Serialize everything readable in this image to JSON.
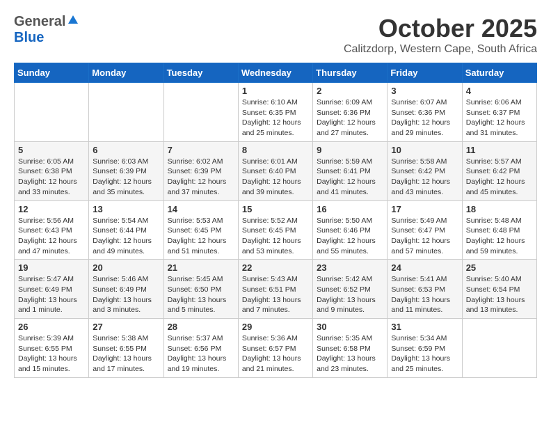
{
  "logo": {
    "general": "General",
    "blue": "Blue"
  },
  "title": "October 2025",
  "subtitle": "Calitzdorp, Western Cape, South Africa",
  "headers": [
    "Sunday",
    "Monday",
    "Tuesday",
    "Wednesday",
    "Thursday",
    "Friday",
    "Saturday"
  ],
  "weeks": [
    [
      {
        "day": "",
        "info": ""
      },
      {
        "day": "",
        "info": ""
      },
      {
        "day": "",
        "info": ""
      },
      {
        "day": "1",
        "info": "Sunrise: 6:10 AM\nSunset: 6:35 PM\nDaylight: 12 hours\nand 25 minutes."
      },
      {
        "day": "2",
        "info": "Sunrise: 6:09 AM\nSunset: 6:36 PM\nDaylight: 12 hours\nand 27 minutes."
      },
      {
        "day": "3",
        "info": "Sunrise: 6:07 AM\nSunset: 6:36 PM\nDaylight: 12 hours\nand 29 minutes."
      },
      {
        "day": "4",
        "info": "Sunrise: 6:06 AM\nSunset: 6:37 PM\nDaylight: 12 hours\nand 31 minutes."
      }
    ],
    [
      {
        "day": "5",
        "info": "Sunrise: 6:05 AM\nSunset: 6:38 PM\nDaylight: 12 hours\nand 33 minutes."
      },
      {
        "day": "6",
        "info": "Sunrise: 6:03 AM\nSunset: 6:39 PM\nDaylight: 12 hours\nand 35 minutes."
      },
      {
        "day": "7",
        "info": "Sunrise: 6:02 AM\nSunset: 6:39 PM\nDaylight: 12 hours\nand 37 minutes."
      },
      {
        "day": "8",
        "info": "Sunrise: 6:01 AM\nSunset: 6:40 PM\nDaylight: 12 hours\nand 39 minutes."
      },
      {
        "day": "9",
        "info": "Sunrise: 5:59 AM\nSunset: 6:41 PM\nDaylight: 12 hours\nand 41 minutes."
      },
      {
        "day": "10",
        "info": "Sunrise: 5:58 AM\nSunset: 6:42 PM\nDaylight: 12 hours\nand 43 minutes."
      },
      {
        "day": "11",
        "info": "Sunrise: 5:57 AM\nSunset: 6:42 PM\nDaylight: 12 hours\nand 45 minutes."
      }
    ],
    [
      {
        "day": "12",
        "info": "Sunrise: 5:56 AM\nSunset: 6:43 PM\nDaylight: 12 hours\nand 47 minutes."
      },
      {
        "day": "13",
        "info": "Sunrise: 5:54 AM\nSunset: 6:44 PM\nDaylight: 12 hours\nand 49 minutes."
      },
      {
        "day": "14",
        "info": "Sunrise: 5:53 AM\nSunset: 6:45 PM\nDaylight: 12 hours\nand 51 minutes."
      },
      {
        "day": "15",
        "info": "Sunrise: 5:52 AM\nSunset: 6:45 PM\nDaylight: 12 hours\nand 53 minutes."
      },
      {
        "day": "16",
        "info": "Sunrise: 5:50 AM\nSunset: 6:46 PM\nDaylight: 12 hours\nand 55 minutes."
      },
      {
        "day": "17",
        "info": "Sunrise: 5:49 AM\nSunset: 6:47 PM\nDaylight: 12 hours\nand 57 minutes."
      },
      {
        "day": "18",
        "info": "Sunrise: 5:48 AM\nSunset: 6:48 PM\nDaylight: 12 hours\nand 59 minutes."
      }
    ],
    [
      {
        "day": "19",
        "info": "Sunrise: 5:47 AM\nSunset: 6:49 PM\nDaylight: 13 hours\nand 1 minute."
      },
      {
        "day": "20",
        "info": "Sunrise: 5:46 AM\nSunset: 6:49 PM\nDaylight: 13 hours\nand 3 minutes."
      },
      {
        "day": "21",
        "info": "Sunrise: 5:45 AM\nSunset: 6:50 PM\nDaylight: 13 hours\nand 5 minutes."
      },
      {
        "day": "22",
        "info": "Sunrise: 5:43 AM\nSunset: 6:51 PM\nDaylight: 13 hours\nand 7 minutes."
      },
      {
        "day": "23",
        "info": "Sunrise: 5:42 AM\nSunset: 6:52 PM\nDaylight: 13 hours\nand 9 minutes."
      },
      {
        "day": "24",
        "info": "Sunrise: 5:41 AM\nSunset: 6:53 PM\nDaylight: 13 hours\nand 11 minutes."
      },
      {
        "day": "25",
        "info": "Sunrise: 5:40 AM\nSunset: 6:54 PM\nDaylight: 13 hours\nand 13 minutes."
      }
    ],
    [
      {
        "day": "26",
        "info": "Sunrise: 5:39 AM\nSunset: 6:55 PM\nDaylight: 13 hours\nand 15 minutes."
      },
      {
        "day": "27",
        "info": "Sunrise: 5:38 AM\nSunset: 6:55 PM\nDaylight: 13 hours\nand 17 minutes."
      },
      {
        "day": "28",
        "info": "Sunrise: 5:37 AM\nSunset: 6:56 PM\nDaylight: 13 hours\nand 19 minutes."
      },
      {
        "day": "29",
        "info": "Sunrise: 5:36 AM\nSunset: 6:57 PM\nDaylight: 13 hours\nand 21 minutes."
      },
      {
        "day": "30",
        "info": "Sunrise: 5:35 AM\nSunset: 6:58 PM\nDaylight: 13 hours\nand 23 minutes."
      },
      {
        "day": "31",
        "info": "Sunrise: 5:34 AM\nSunset: 6:59 PM\nDaylight: 13 hours\nand 25 minutes."
      },
      {
        "day": "",
        "info": ""
      }
    ]
  ]
}
